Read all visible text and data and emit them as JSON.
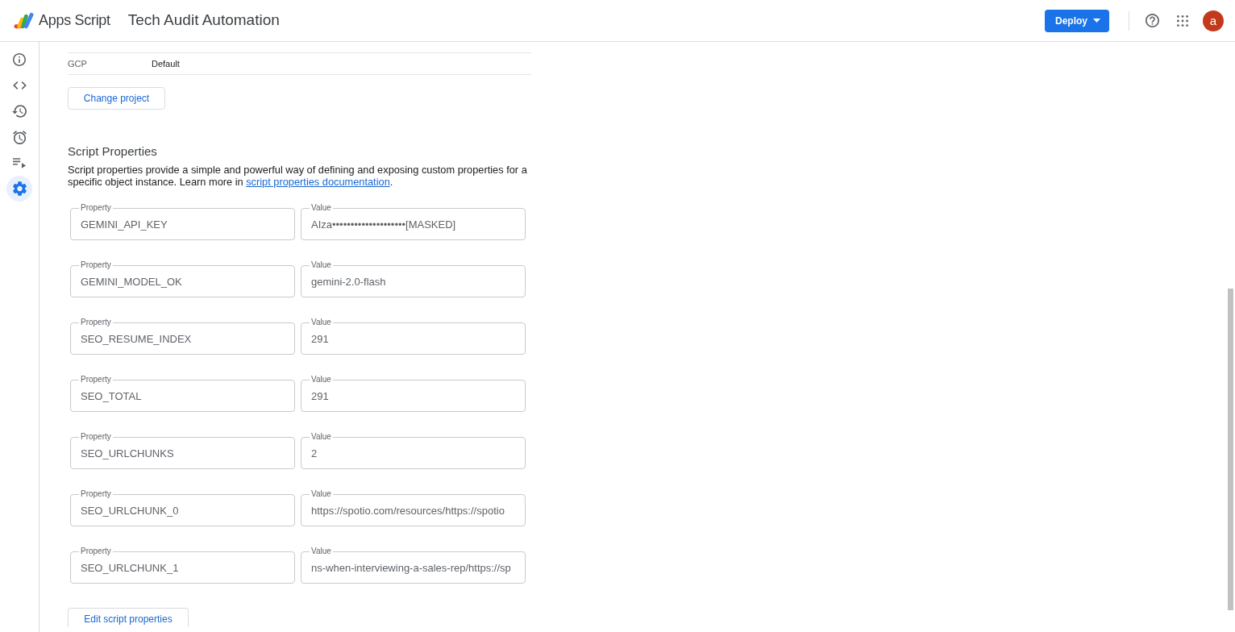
{
  "header": {
    "app_name": "Apps Script",
    "project_title": "Tech Audit Automation",
    "deploy_button": "Deploy",
    "avatar": "a"
  },
  "sidebar": {
    "items": [
      {
        "selected": false
      },
      {
        "selected": false
      },
      {
        "selected": false
      },
      {
        "selected": false
      },
      {
        "selected": false
      },
      {
        "selected": true
      }
    ]
  },
  "cloud_project": {
    "rows": [
      {
        "label": "GCP",
        "value": "Default"
      }
    ],
    "change_button": "Change project"
  },
  "script_properties": {
    "title": "Script Properties",
    "description": "Script properties provide a simple and powerful way of defining and exposing custom properties for a specific object instance. Learn more in",
    "doc_link": "script properties documentation",
    "description_end": ".",
    "entries": [
      {
        "property_label": "Property",
        "property": "GEMINI_API_KEY",
        "value_label": "Value",
        "value": "AIza••••••••••••••••••••[MASKED]"
      },
      {
        "property_label": "Property",
        "property": "GEMINI_MODEL_OK",
        "value_label": "Value",
        "value": "gemini-2.0-flash"
      },
      {
        "property_label": "Property",
        "property": "SEO_RESUME_INDEX",
        "value_label": "Value",
        "value": "291"
      },
      {
        "property_label": "Property",
        "property": "SEO_TOTAL",
        "value_label": "Value",
        "value": "291"
      },
      {
        "property_label": "Property",
        "property": "SEO_URLCHUNKS",
        "value_label": "Value",
        "value": "2"
      },
      {
        "property_label": "Property",
        "property": "SEO_URLCHUNK_0",
        "value_label": "Value",
        "value": "https://spotio.com/resources/https://spotio"
      },
      {
        "property_label": "Property",
        "property": "SEO_URLCHUNK_1",
        "value_label": "Value",
        "value": "ns-when-interviewing-a-sales-rep/https://sp"
      }
    ],
    "edit_button": "Edit script properties"
  }
}
